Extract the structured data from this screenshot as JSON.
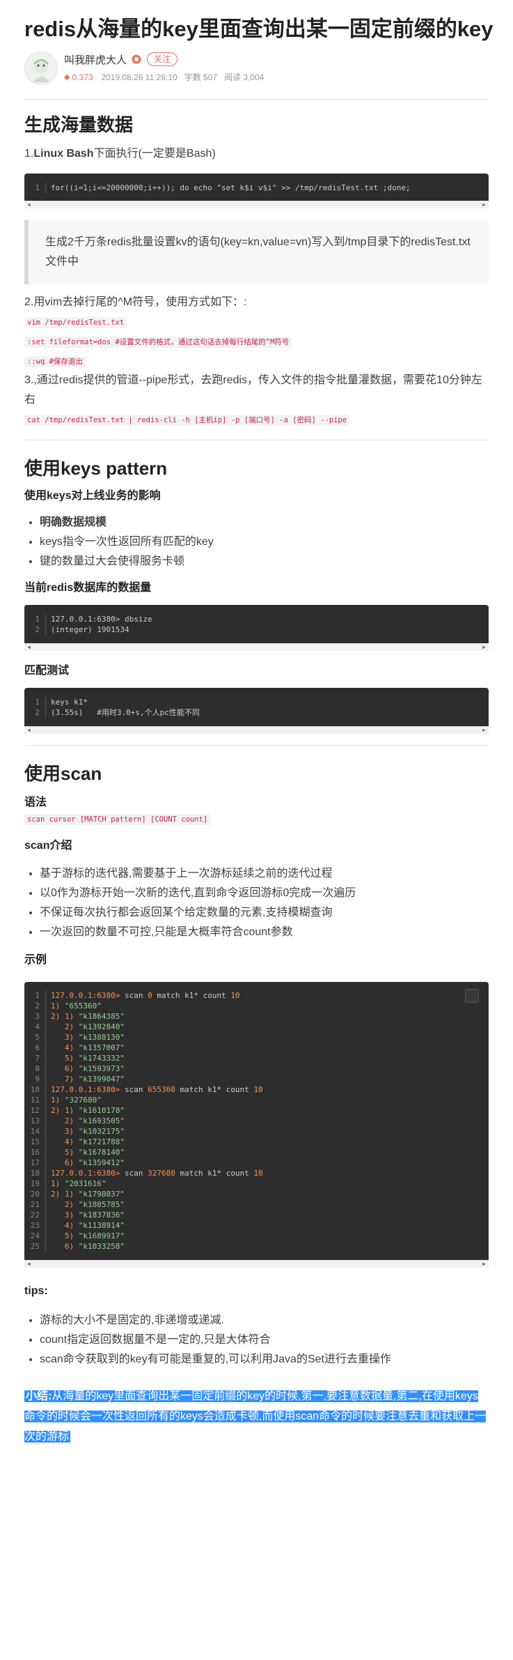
{
  "article": {
    "title": "redis从海量的key里面查询出某一固定前缀的key",
    "author": "叫我胖虎大人",
    "follow_label": "关注",
    "stats": {
      "amount": "0.373",
      "date": "2019.08.26 11:26:10",
      "word_count": "字数 507",
      "reads": "阅读 3,004"
    }
  },
  "section1": {
    "heading": "生成海量数据",
    "step1_prefix": "1.",
    "step1_bold": "Linux Bash",
    "step1_rest": "下面执行(一定要是Bash)",
    "code1": [
      "for((i=1;i<=20000000;i++)); do echo \"set k$i v$i\" >> /tmp/redisTest.txt ;done;"
    ],
    "quote": "生成2千万条redis批量设置kv的语句(key=kn,value=vn)写入到/tmp目录下的redisTest.txt文件中",
    "step2": "2.用vim去掉行尾的^M符号，使用方式如下：:",
    "inline1": "vim /tmp/redisTest.txt",
    "inline2": ":set fileformat=dos #设置文件的格式，通过这句话去掉每行结尾的^M符号",
    "inline3": "::wq #保存退出",
    "step3": "3.,通过redis提供的管道--pipe形式，去跑redis，传入文件的指令批量灌数据，需要花10分钟左右",
    "inline4": "cat /tmp/redisTest.txt | redis-cli -h [主机ip] -p [端口号] -a [密码] --pipe"
  },
  "section2": {
    "heading": "使用keys pattern",
    "sub1": "使用keys对上线业务的影响",
    "bullets": [
      "明确数据规模",
      "keys指令一次性返回所有匹配的key",
      "键的数量过大会使得服务卡顿"
    ],
    "sub2": "当前redis数据库的数据量",
    "code2": [
      "127.0.0.1:6380> dbsize",
      "(integer) 1901534"
    ],
    "sub3": "匹配测试",
    "code3": [
      "keys k1*",
      "(3.55s)   #用时3.0+s,个人pc性能不同"
    ]
  },
  "section3": {
    "heading": "使用scan",
    "sub1": "语法",
    "syntax": "scan cursor [MATCH pattern] [COUNT count]",
    "sub2": "scan介绍",
    "bullets": [
      "基于游标的迭代器,需要基于上一次游标延续之前的迭代过程",
      "以0作为游标开始一次新的迭代,直到命令返回游标0完成一次遍历",
      "不保证每次执行都会返回某个给定数量的元素,支持模糊查询",
      "一次返回的数量不可控,只能是大概率符合count参数"
    ],
    "sub3": "示例",
    "code4": [
      {
        "t": "cmd",
        "prompt": "127.0.0.1:6380>",
        "cmd": " scan ",
        "a": "0",
        "m": " match k1* count ",
        "b": "10"
      },
      {
        "t": "res",
        "idx": "1)",
        "val": " \"655360\""
      },
      {
        "t": "res",
        "idx": "2) 1)",
        "val": " \"k1864385\""
      },
      {
        "t": "sub",
        "idx": "   2)",
        "val": " \"k1392840\""
      },
      {
        "t": "sub",
        "idx": "   3)",
        "val": " \"k1388130\""
      },
      {
        "t": "sub",
        "idx": "   4)",
        "val": " \"k1357007\""
      },
      {
        "t": "sub",
        "idx": "   5)",
        "val": " \"k1743332\""
      },
      {
        "t": "sub",
        "idx": "   6)",
        "val": " \"k1593973\""
      },
      {
        "t": "sub",
        "idx": "   7)",
        "val": " \"k1399047\""
      },
      {
        "t": "cmd",
        "prompt": "127.0.0.1:6380>",
        "cmd": " scan ",
        "a": "655360",
        "m": " match k1* count ",
        "b": "10"
      },
      {
        "t": "res",
        "idx": "1)",
        "val": " \"327680\""
      },
      {
        "t": "res",
        "idx": "2) 1)",
        "val": " \"k1610178\""
      },
      {
        "t": "sub",
        "idx": "   2)",
        "val": " \"k1693505\""
      },
      {
        "t": "sub",
        "idx": "   3)",
        "val": " \"k1032175\""
      },
      {
        "t": "sub",
        "idx": "   4)",
        "val": " \"k1721788\""
      },
      {
        "t": "sub",
        "idx": "   5)",
        "val": " \"k1678140\""
      },
      {
        "t": "sub",
        "idx": "   6)",
        "val": " \"k1359412\""
      },
      {
        "t": "cmd",
        "prompt": "127.0.0.1:6380>",
        "cmd": " scan ",
        "a": "327680",
        "m": " match k1* count ",
        "b": "10"
      },
      {
        "t": "res",
        "idx": "1)",
        "val": " \"2031616\""
      },
      {
        "t": "res",
        "idx": "2) 1)",
        "val": " \"k1798037\""
      },
      {
        "t": "sub",
        "idx": "   2)",
        "val": " \"k1805785\""
      },
      {
        "t": "sub",
        "idx": "   3)",
        "val": " \"k1837836\""
      },
      {
        "t": "sub",
        "idx": "   4)",
        "val": " \"k1138914\""
      },
      {
        "t": "sub",
        "idx": "   5)",
        "val": " \"k1689917\""
      },
      {
        "t": "sub",
        "idx": "   6)",
        "val": " \"k1033258\""
      }
    ],
    "tips_heading": "tips:",
    "tips": [
      "游标的大小不是固定的,非递增或递减.",
      "count指定返回数据量不是一定的,只是大体符合",
      "scan命令获取到的key有可能是重复的,可以利用Java的Set进行去重操作"
    ],
    "summary_bold": "小结:",
    "summary_text": "从海量的key里面查询出某一固定前缀的key的时候,第一,要注意数据量,第二,在使用keys命令的时候会一次性返回所有的keys会造成卡顿,而使用scan命令的时候要注意去重和获取上一次的游标"
  },
  "colors": {
    "accent": "#ec7259",
    "code_bg": "#2d2d2d",
    "highlight": "#3390ff"
  },
  "icons": {
    "badge": "verified-badge-icon",
    "diamond": "diamond-icon",
    "copy": "copy-icon"
  }
}
